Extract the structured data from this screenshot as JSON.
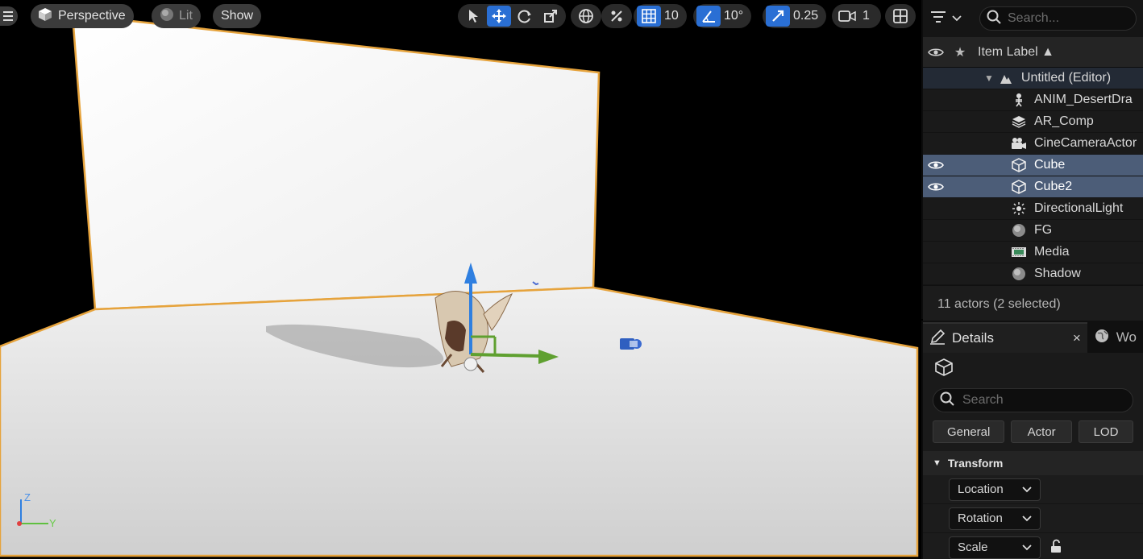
{
  "viewport": {
    "perspective_label": "Perspective",
    "lit_label": "Lit",
    "show_label": "Show",
    "grid_snap_value": "10",
    "rotation_snap_value": "10°",
    "scale_snap_value": "0.25",
    "camera_speed_value": "1",
    "axis_z": "Z",
    "axis_y": "Y",
    "outline_color": "#e6a33c",
    "icons": [
      "menu-icon",
      "cube-icon",
      "sphere-icon",
      "select-arrow-icon",
      "move-icon",
      "rotate-icon",
      "scale-icon",
      "world-icon",
      "surface-snap-icon",
      "grid-icon",
      "angle-icon",
      "scale-snap-icon",
      "camera-icon",
      "layout-icon"
    ]
  },
  "outliner": {
    "search_placeholder": "Search...",
    "column_label": "Item Label ▲",
    "items": [
      {
        "label": "Untitled (Editor)",
        "icon": "world-icon",
        "kind": "world"
      },
      {
        "label": "ANIM_DesertDra",
        "icon": "skeleton-icon",
        "kind": "normal"
      },
      {
        "label": "AR_Comp",
        "icon": "layers-icon",
        "kind": "normal"
      },
      {
        "label": "CineCameraActor",
        "icon": "cine-camera-icon",
        "kind": "normal"
      },
      {
        "label": "Cube",
        "icon": "cube-outline-icon",
        "kind": "selected"
      },
      {
        "label": "Cube2",
        "icon": "cube-outline-icon",
        "kind": "selected"
      },
      {
        "label": "DirectionalLight",
        "icon": "sun-icon",
        "kind": "normal"
      },
      {
        "label": "FG",
        "icon": "sphere-icon",
        "kind": "normal"
      },
      {
        "label": "Media",
        "icon": "film-icon",
        "kind": "normal"
      },
      {
        "label": "Shadow",
        "icon": "sphere-icon",
        "kind": "normal"
      }
    ],
    "footer": "11 actors (2 selected)"
  },
  "details": {
    "tab_label": "Details",
    "tab_close": "×",
    "other_tab_label": "Wo",
    "search_placeholder": "Search",
    "filters": [
      "General",
      "Actor",
      "LOD"
    ],
    "section": "Transform",
    "props": [
      "Location",
      "Rotation",
      "Scale"
    ]
  }
}
